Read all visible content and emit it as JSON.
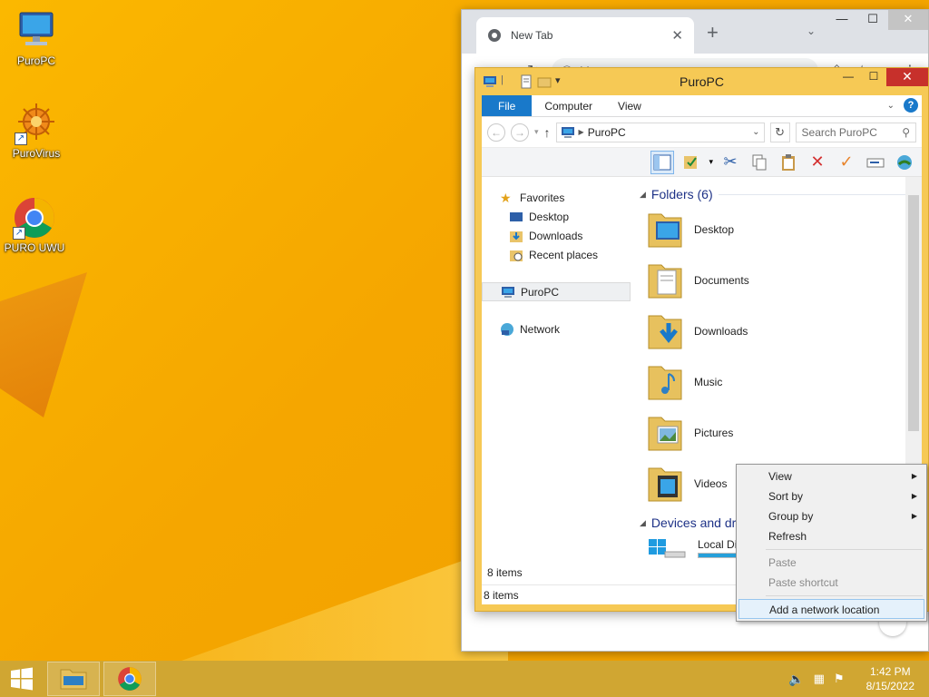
{
  "desktop": {
    "icons": [
      {
        "label": "PuroPC"
      },
      {
        "label": "PuroVirus"
      },
      {
        "label": "PURO UWU"
      }
    ]
  },
  "chrome": {
    "tab_title": "New Tab",
    "tab_close": "✕",
    "new_tab": "+",
    "url": "bing.com"
  },
  "explorer": {
    "title": "PuroPC",
    "ribbon_tabs": [
      "File",
      "Computer",
      "View"
    ],
    "address": "PuroPC",
    "search_placeholder": "Search PuroPC",
    "nav": {
      "favorites": "Favorites",
      "desktop": "Desktop",
      "downloads": "Downloads",
      "recent": "Recent places",
      "this_pc": "PuroPC",
      "network": "Network"
    },
    "folders_header": "Folders (6)",
    "folders": [
      "Desktop",
      "Documents",
      "Downloads",
      "Music",
      "Pictures",
      "Videos"
    ],
    "devices_header": "Devices and dr",
    "local_disk": "Local Disk",
    "disk_used_fraction": 0.45,
    "status_items": "8 items",
    "status_items_bottom": "8 items"
  },
  "context_menu": {
    "view": "View",
    "sort_by": "Sort by",
    "group_by": "Group by",
    "refresh": "Refresh",
    "paste": "Paste",
    "paste_shortcut": "Paste shortcut",
    "add_network_location": "Add a network location"
  },
  "taskbar": {
    "time": "1:42 PM",
    "date": "8/15/2022"
  },
  "colors": {
    "accent": "#1979ca",
    "window_frame": "#f6c955",
    "close_red": "#c7302b",
    "taskbar": "#d0a632"
  }
}
